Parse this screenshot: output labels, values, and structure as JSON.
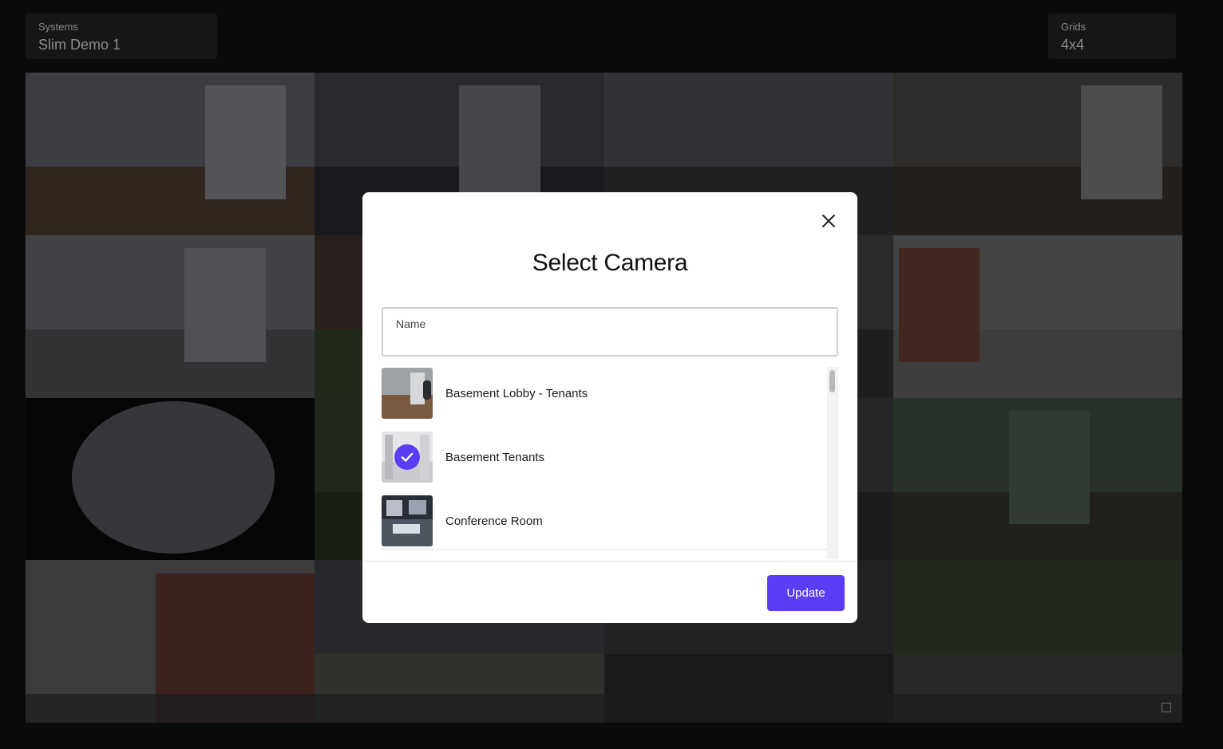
{
  "header": {
    "systems": {
      "label": "Systems",
      "value": "Slim Demo 1"
    },
    "grids": {
      "label": "Grids",
      "value": "4x4"
    }
  },
  "colors": {
    "accent": "#5b3df5",
    "background": "#0b0b0c",
    "modal_background": "#ffffff"
  },
  "modal": {
    "title": "Select Camera",
    "search": {
      "label": "Name",
      "value": ""
    },
    "cameras": [
      {
        "name": "Basement Lobby - Tenants",
        "selected": false
      },
      {
        "name": "Basement Tenants",
        "selected": true
      },
      {
        "name": "Conference Room",
        "selected": false
      }
    ],
    "update_label": "Update"
  }
}
